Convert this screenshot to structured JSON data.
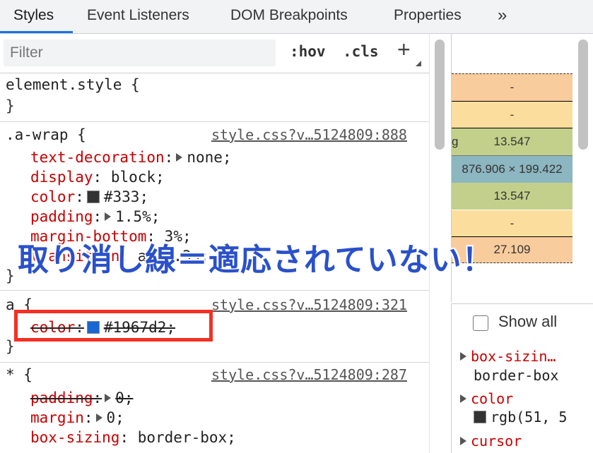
{
  "tabs": [
    {
      "label": "Styles",
      "active": true
    },
    {
      "label": "Event Listeners"
    },
    {
      "label": "DOM Breakpoints"
    },
    {
      "label": "Properties"
    },
    {
      "label": "»"
    }
  ],
  "filter": {
    "placeholder": "Filter",
    "hov": ":hov",
    "cls": ".cls",
    "add": "+"
  },
  "rules": {
    "element_style": {
      "selector": "element.style {",
      "close": "}"
    },
    "a_wrap": {
      "selector": ".a-wrap {",
      "source": "style.css?v…5124809:888",
      "decl1_prop": "text-decoration",
      "decl1_val": "none;",
      "decl2_prop": "display",
      "decl2_val": "block;",
      "decl3_prop": "color",
      "decl3_val": "#333;",
      "decl4_prop": "padding",
      "decl4_val": "1.5%;",
      "decl5_prop": "margin-bottom",
      "decl5_val": "3%;",
      "decl6_prop": "transition",
      "decl6_val": "all .3s;",
      "close": "}"
    },
    "a": {
      "selector": "a {",
      "source": "style.css?v…5124809:321",
      "decl1_prop": "color",
      "decl1_val": "#1967d2;",
      "close": "}"
    },
    "star": {
      "selector": "* {",
      "source": "style.css?v…5124809:287",
      "decl1_prop": "padding",
      "decl1_val": "0;",
      "decl2_prop": "margin",
      "decl2_val": "0;",
      "decl3_prop": "box-sizing",
      "decl3_val": "border-box;"
    }
  },
  "boxmodel": {
    "margin": "-",
    "border": "-",
    "padding": "13.547",
    "padding_left": "g",
    "content": "876.906 × 199.422",
    "padding_bottom": "13.547",
    "border_bottom": "-",
    "margin_bottom": "27.109"
  },
  "computed": {
    "show_all": "Show all",
    "prop1": "box-sizin…",
    "val1": "border-box",
    "prop2": "color",
    "val2": "rgb(51, 5",
    "prop3": "cursor"
  },
  "annotation": {
    "text": "取り消し線＝適応されていない！"
  },
  "colors": {
    "swatch_333": "#333333",
    "swatch_1967d2": "#1967d2",
    "accent": "#1a73e8",
    "annotation_blue": "#2a51ca",
    "highlight_red": "#f42f24"
  }
}
